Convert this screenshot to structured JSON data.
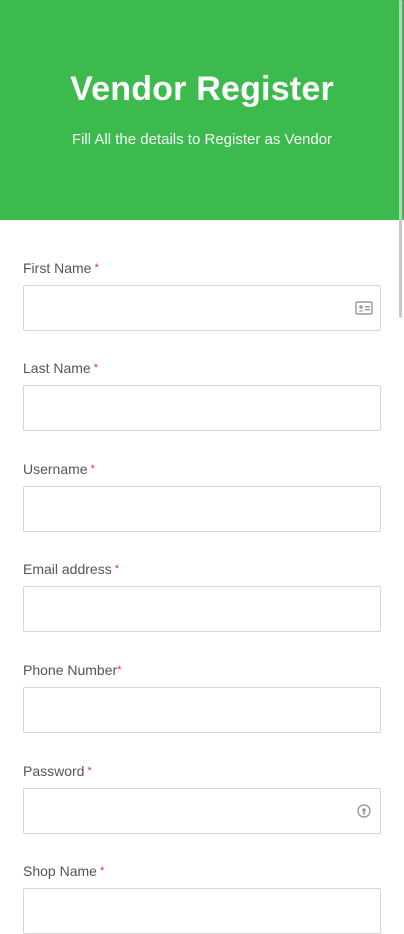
{
  "header": {
    "title": "Vendor Register",
    "subtitle": "Fill All the details to Register as Vendor"
  },
  "form": {
    "fields": [
      {
        "label": "First Name",
        "required_mark": "*",
        "value": "",
        "icon": "contact-card-icon"
      },
      {
        "label": "Last Name",
        "required_mark": "*",
        "value": ""
      },
      {
        "label": "Username",
        "required_mark": "*",
        "value": ""
      },
      {
        "label": "Email address",
        "required_mark": "*",
        "value": ""
      },
      {
        "label": "Phone Number",
        "required_mark": "*",
        "value": ""
      },
      {
        "label": "Password",
        "required_mark": "*",
        "value": "",
        "icon": "password-key-icon"
      },
      {
        "label": "Shop Name",
        "required_mark": "*",
        "value": ""
      }
    ]
  },
  "colors": {
    "header_bg": "#3dba4e",
    "required": "#e03030",
    "input_border": "#d6d6d6"
  }
}
